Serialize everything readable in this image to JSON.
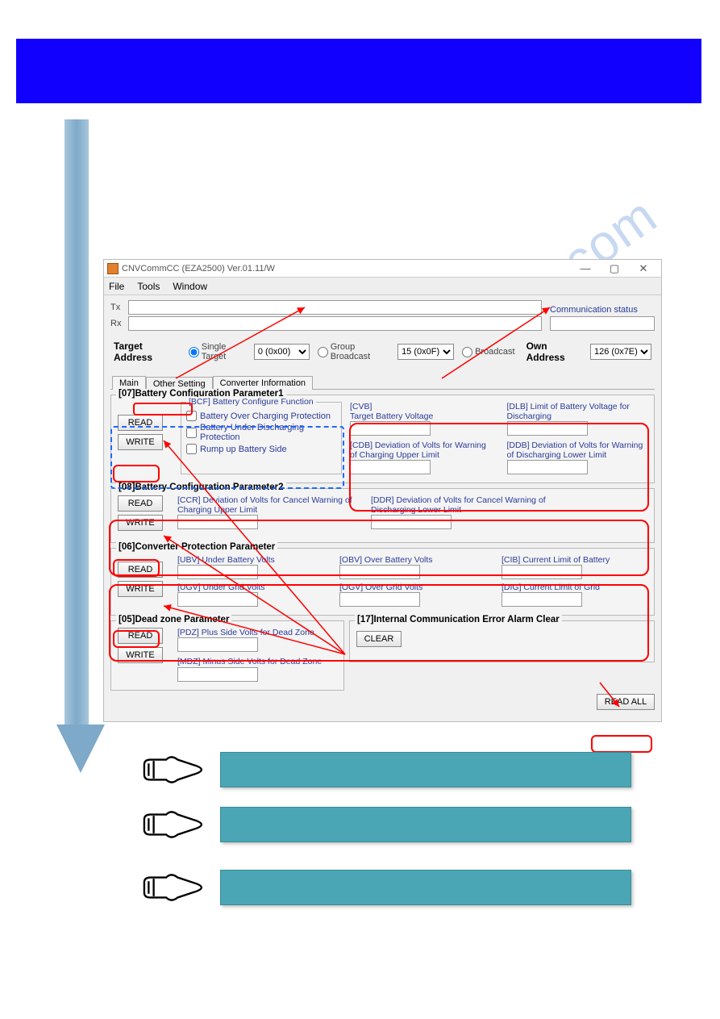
{
  "window": {
    "title": "CNVCommCC (EZA2500) Ver.01.11/W",
    "menu": {
      "file": "File",
      "tools": "Tools",
      "window": "Window"
    },
    "win_min": "—",
    "win_max": "▢",
    "win_close": "✕"
  },
  "txrx": {
    "tx_label": "Tx",
    "rx_label": "Rx",
    "comm_label": "Communication status"
  },
  "address": {
    "target_label": "Target Address",
    "single": "Single Target",
    "single_val": "0 (0x00)",
    "group": "Group Broadcast",
    "group_val": "15 (0x0F)",
    "broadcast": "Broadcast",
    "own_label": "Own Address",
    "own_val": "126 (0x7E)"
  },
  "tabs": {
    "main": "Main",
    "other": "Other Setting",
    "conv": "Converter Information"
  },
  "btns": {
    "read": "READ",
    "write": "WRITE",
    "clear": "CLEAR",
    "readall": "READ ALL"
  },
  "g07": {
    "title": "[07]Battery Configuration Parameter1",
    "bcf_title": "[BCF] Battery Configure Function",
    "cb1": "Battery Over Charging Protection",
    "cb2": "Battery Under Discharging Protection",
    "cb3": "Rump up Battery Side",
    "cvb": "[CVB]\nTarget Battery Voltage",
    "dlb": "[DLB] Limit of Battery Voltage for Discharging",
    "cdb": "[CDB] Deviation of Volts for Warning of Charging Upper Limit",
    "ddb": "[DDB] Deviation of Volts for Warning of Discharging Lower Limit"
  },
  "g08": {
    "title": "[08]Battery Configuration Parameter2",
    "ccr": "[CCR] Deviation of Volts for Cancel Warning of Charging Upper Limit",
    "ddr": "[DDR] Deviation of Volts for Cancel Warning of Discharging Lower Limit"
  },
  "g06": {
    "title": "[06]Converter Protection Parameter",
    "ubv": "[UBV] Under Battery Volts",
    "obv": "[OBV] Over Battery Volts",
    "cib": "[CIB] Current Limit of Battery",
    "ugv": "[UGV] Under Grid Volts",
    "ogv": "[OGV] Over Grid Volts",
    "dig": "[DIG] Current Limit of Grid"
  },
  "g05": {
    "title": "[05]Dead zone Parameter",
    "pdz": "[PDZ] Plus Side Volts for Dead Zone",
    "mdz": "[MDZ] Minus Side Volts for Dead Zone"
  },
  "g17": {
    "title": "[17]Internal Communication Error Alarm Clear"
  },
  "watermark": "manualshive.com"
}
